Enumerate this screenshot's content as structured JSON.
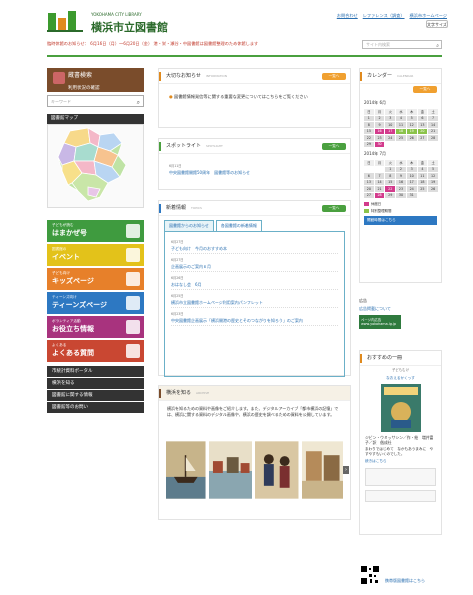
{
  "header": {
    "logo_en": "YOKOHAMA CITY LIBRARY",
    "logo_jp": "横浜市立図書館",
    "links": [
      "お問合わせ",
      "レファレンス（調査）",
      "横浜市ホームページ"
    ],
    "font_button": "文字サイズ",
    "closed_notice": "臨時休館のお知らせ： 6月16日（月）～6月20日（金） 港・栄・瀬谷・中図書館は図書館整理のため休館します",
    "search_placeholder": "サイト内検索"
  },
  "left": {
    "catalog": {
      "title": "蔵書検索",
      "subtitle": "利用状況の確認",
      "placeholder": "キーワード"
    },
    "map_title": "図書館マップ",
    "banners": [
      {
        "small": "子どもが読む",
        "large": "はまかぜ号",
        "color": "#3f9b3f"
      },
      {
        "small": "図書館の",
        "large": "イベント",
        "color": "#e3c21a"
      },
      {
        "small": "子ども向け",
        "large": "キッズページ",
        "color": "#e7802a"
      },
      {
        "small": "ティーンズ向け",
        "large": "ティーンズページ",
        "color": "#2d78c2"
      },
      {
        "small": "ボランティア活動",
        "large": "お役立ち情報",
        "color": "#a8337e"
      },
      {
        "small": "よくある",
        "large": "よくある質問",
        "color": "#c94732"
      }
    ],
    "buttons": [
      "市統計資料ポータル",
      "横浜を知る",
      "図書館に関する情報",
      "図書館等のお問い"
    ]
  },
  "main": {
    "notice": {
      "title": "大切なお知らせ",
      "sub": "INFORMATION",
      "more": "一覧へ",
      "item": "図書館情報発信等に関する重要な変更についてはこちらをご覧ください"
    },
    "spotlight": {
      "title": "スポットライト",
      "sub": "SPOTLIGHT",
      "more": "一覧へ",
      "date": "6月11日",
      "text": "中央図書館開館50周年　図書館等のお知らせ"
    },
    "news": {
      "title": "新着情報",
      "sub": "TOPICS",
      "more": "一覧へ",
      "tabs": [
        "図書館からのお知らせ",
        "各図書館の新着情報"
      ],
      "items": [
        {
          "date": "6月27日",
          "text": "子ども向け　今月のおすすめ本"
        },
        {
          "date": "6月27日",
          "text": "企画展示のご案内６月"
        },
        {
          "date": "6月26日",
          "text": "おはなし会　6月"
        },
        {
          "date": "6月25日",
          "text": "横浜市立図書館ホームページ利用案内パンフレット"
        },
        {
          "date": "6月23日",
          "text": "中央図書館企画展示「横浜開港の歴史とそのつながりを知ろう」のご案内"
        }
      ]
    },
    "yokohama": {
      "title": "横浜を知る",
      "sub": "ARCHIVE",
      "text": "横浜を知るための資料や画像をご紹介します。また、デジタルアーカイブ「都市横浜の記憶」では、横浜に関する資料のデジタル画像や、横浜の歴史を調べるための資料を公開しています。"
    }
  },
  "right": {
    "calendar": {
      "title": "カレンダー",
      "sub": "CALENDAR",
      "more": "一覧へ",
      "months": [
        {
          "label": "2014年 6月",
          "rows": [
            [
              "日",
              "月",
              "火",
              "水",
              "木",
              "金",
              "土"
            ],
            [
              "1",
              "2",
              "3",
              "4",
              "5",
              "6",
              "7"
            ],
            [
              "8",
              "9",
              "10",
              "11",
              "12",
              "13",
              "14"
            ],
            [
              "15",
              "16",
              "17",
              "18",
              "19",
              "20",
              "21"
            ],
            [
              "22",
              "23",
              "24",
              "25",
              "26",
              "27",
              "28"
            ],
            [
              "29",
              "30",
              "",
              "",
              "",
              "",
              ""
            ]
          ]
        },
        {
          "label": "2014年 7月",
          "rows": [
            [
              "日",
              "月",
              "火",
              "水",
              "木",
              "金",
              "土"
            ],
            [
              "",
              "",
              "1",
              "2",
              "3",
              "4",
              "5"
            ],
            [
              "6",
              "7",
              "8",
              "9",
              "10",
              "11",
              "12"
            ],
            [
              "13",
              "14",
              "15",
              "16",
              "17",
              "18",
              "19"
            ],
            [
              "20",
              "21",
              "22",
              "23",
              "24",
              "25",
              "26"
            ],
            [
              "27",
              "28",
              "29",
              "30",
              "31",
              "",
              ""
            ]
          ]
        }
      ],
      "legend": [
        "休館日",
        "特別整理期間"
      ],
      "link": "開館時間はこちら"
    },
    "ad": {
      "label": "広告",
      "link": "広告掲載について",
      "sponsor": "ページ内広告",
      "sponsor_sub": "www.yokohama.lg.jp"
    },
    "pick": {
      "title": "おすすめの一冊",
      "sub": "子どもむけ",
      "book_label": "なおえるかくっす",
      "caption": "ジビン・ウミッサシン／作・絵　増井富子／訳　偕成社",
      "desc": "まわりではじめて　なかもあうまみに　やすやすもいくのでした。",
      "link": "続きはこちら"
    },
    "qr_label": "携帯版図書館はこちら"
  }
}
